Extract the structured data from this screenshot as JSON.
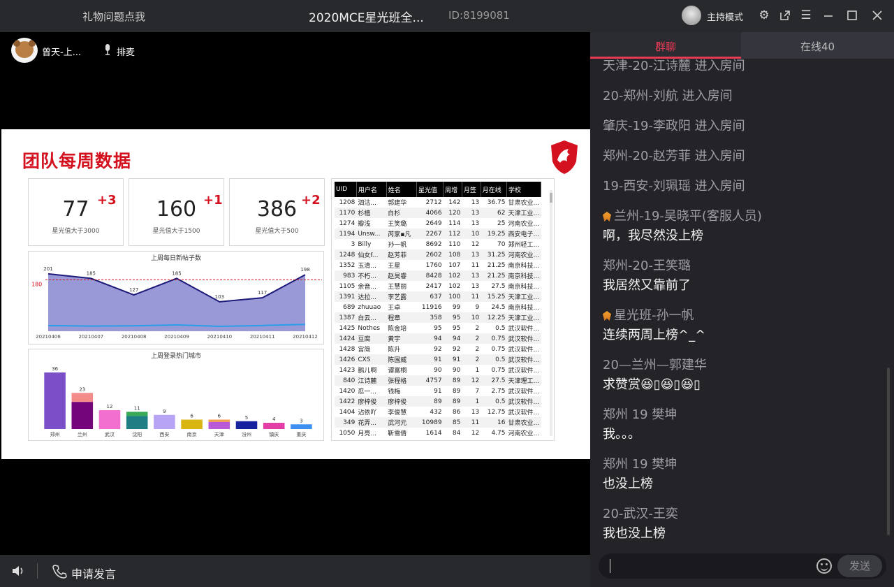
{
  "titlebar": {
    "left_label": "礼物问题点我",
    "room_title": "2020MCE星光班全...",
    "room_id": "ID:8199081",
    "mode_label": "主持模式"
  },
  "stage": {
    "host_name": "曾天-上...",
    "mic_label": "排麦"
  },
  "slide": {
    "title": "团队每周数据",
    "stats": [
      {
        "value": "77",
        "delta": "+3",
        "caption": "星光值大于3000"
      },
      {
        "value": "160",
        "delta": "+1",
        "caption": "星光值大于1500"
      },
      {
        "value": "386",
        "delta": "+2",
        "caption": "星光值大于500"
      }
    ],
    "table": {
      "headers": [
        "UID",
        "用户名",
        "姓名",
        "星光值",
        "周增",
        "月签",
        "月在线",
        "学校"
      ],
      "rows": [
        [
          "1208",
          "泗沽...",
          "郭建华",
          "2712",
          "142",
          "13",
          "36.75",
          "甘肃农业..."
        ],
        [
          "1170",
          "杉樯",
          "白杉",
          "4066",
          "120",
          "13",
          "62",
          "天津工业..."
        ],
        [
          "1274",
          "瓣浅",
          "王笑璐",
          "2649",
          "114",
          "13",
          "25",
          "河南农业..."
        ],
        [
          "1194",
          "Unsw...",
          "芮家▪凡",
          "2267",
          "112",
          "10",
          "19.25",
          "西安电子..."
        ],
        [
          "3",
          "Billy",
          "孙一帆",
          "8692",
          "110",
          "12",
          "70",
          "郑州轻工..."
        ],
        [
          "1248",
          "仙女f...",
          "赵芳菲",
          "2602",
          "108",
          "13",
          "31.25",
          "河南农业..."
        ],
        [
          "1352",
          "玉清...",
          "王星",
          "1760",
          "107",
          "11",
          "21.25",
          "南京科技..."
        ],
        [
          "983",
          "不朽...",
          "赵昊睿",
          "8428",
          "102",
          "13",
          "21.25",
          "南京科技..."
        ],
        [
          "1105",
          "余音...",
          "王慧丽",
          "2417",
          "102",
          "13",
          "27.5",
          "南京科技..."
        ],
        [
          "1391",
          "达拉...",
          "李艺露",
          "637",
          "100",
          "11",
          "15.25",
          "天津工业..."
        ],
        [
          "689",
          "zhuuao",
          "王卓",
          "11916",
          "99",
          "9",
          "24.5",
          "南京科技..."
        ],
        [
          "1387",
          "白云...",
          "程章",
          "358",
          "95",
          "10",
          "12.25",
          "天津工业..."
        ],
        [
          "1425",
          "Nothes",
          "陈金培",
          "95",
          "95",
          "2",
          "0.5",
          "武汉软件..."
        ],
        [
          "1424",
          "豆腐",
          "黄宇",
          "94",
          "94",
          "2",
          "0.75",
          "武汉软件..."
        ],
        [
          "1428",
          "宫简",
          "陈升",
          "92",
          "92",
          "2",
          "0.75",
          "武汉软件..."
        ],
        [
          "1426",
          "CXS",
          "陈国威",
          "91",
          "91",
          "2",
          "0.5",
          "武汉软件..."
        ],
        [
          "1423",
          "鹅儿啊",
          "谭富桐",
          "90",
          "90",
          "1",
          "0.75",
          "武汉软件..."
        ],
        [
          "840",
          "江诗麓",
          "张程格",
          "4757",
          "89",
          "12",
          "27.5",
          "天津理工..."
        ],
        [
          "1420",
          "忍一...",
          "钱梅",
          "91",
          "89",
          "7",
          "2.75",
          "武汉软件..."
        ],
        [
          "1422",
          "廖梓俊",
          "廖梓俊",
          "89",
          "89",
          "1",
          "0.5",
          "武汉软件..."
        ],
        [
          "1404",
          "沾依吖",
          "李俊慧",
          "432",
          "86",
          "13",
          "12.75",
          "武汉软件..."
        ],
        [
          "349",
          "花弄...",
          "武河元",
          "10989",
          "85",
          "11",
          "16",
          "甘肃农业..."
        ],
        [
          "1050",
          "月亮...",
          "靳雪倩",
          "1614",
          "84",
          "12",
          "4.75",
          "河南农业..."
        ]
      ]
    }
  },
  "chart_data": [
    {
      "type": "area",
      "title": "上周每日新帖子数",
      "x": [
        "20210406",
        "20210407",
        "20210408",
        "20210409",
        "20210410",
        "20210411",
        "20210412"
      ],
      "series": [
        {
          "values": [
            201,
            185,
            127,
            185,
            103,
            117,
            198
          ]
        }
      ],
      "baseline_series": [
        20,
        18,
        19,
        22,
        17,
        20,
        24
      ],
      "reference_line": 180,
      "ylim": [
        0,
        230
      ]
    },
    {
      "type": "bar",
      "title": "上周登录热门城市",
      "categories": [
        "郑州",
        "兰州",
        "武汉",
        "沈阳",
        "西安",
        "南京",
        "天津",
        "汾州",
        "镇庆",
        "重庆"
      ],
      "values": [
        36,
        23,
        12,
        11,
        9,
        6,
        6,
        5,
        4,
        3
      ],
      "ylim": [
        0,
        40
      ],
      "colors": [
        "#7b4fc8",
        "#74057a",
        "#f26fcf",
        "#1f7d84",
        "#b8a4f5",
        "#d8b510",
        "#b85ad8",
        "#17239e",
        "#e23fa6",
        "#3d8ff0"
      ],
      "stack_colors": [
        "",
        "#f48a8a",
        "",
        "#39a957",
        "",
        "",
        "#f0a24a",
        "",
        "",
        ""
      ]
    }
  ],
  "bottombar": {
    "apply_label": "申请发言"
  },
  "chat": {
    "tab_group": "群聊",
    "tab_online": "在线40",
    "input_placeholder": "",
    "send_label": "发送",
    "messages": [
      {
        "name": "天津-20-江诗麓 进入房间",
        "text": ""
      },
      {
        "name": "20-郑州-刘航 进入房间",
        "text": ""
      },
      {
        "name": "肇庆-19-李政阳 进入房间",
        "text": ""
      },
      {
        "name": "郑州-20-赵芳菲 进入房间",
        "text": ""
      },
      {
        "name": "19-西安-刘珮瑶 进入房间",
        "text": ""
      },
      {
        "name": "兰州-19-吴晓平(客服人员)",
        "text": "啊，我尽然没上榜",
        "badge": true
      },
      {
        "name": "郑州-20-王笑璐",
        "text": "我居然又靠前了"
      },
      {
        "name": "星光班-孙一帆",
        "text": "连续两周上榜^_^",
        "badge": true
      },
      {
        "name": "20—兰州—郭建华",
        "text": "求赞赏😆▯😆▯😆▯"
      },
      {
        "name": "郑州 19 樊坤",
        "text": "我。。。"
      },
      {
        "name": "郑州 19 樊坤",
        "text": "也没上榜"
      },
      {
        "name": "20-武汉-王奕",
        "text": "我也没上榜"
      }
    ]
  }
}
